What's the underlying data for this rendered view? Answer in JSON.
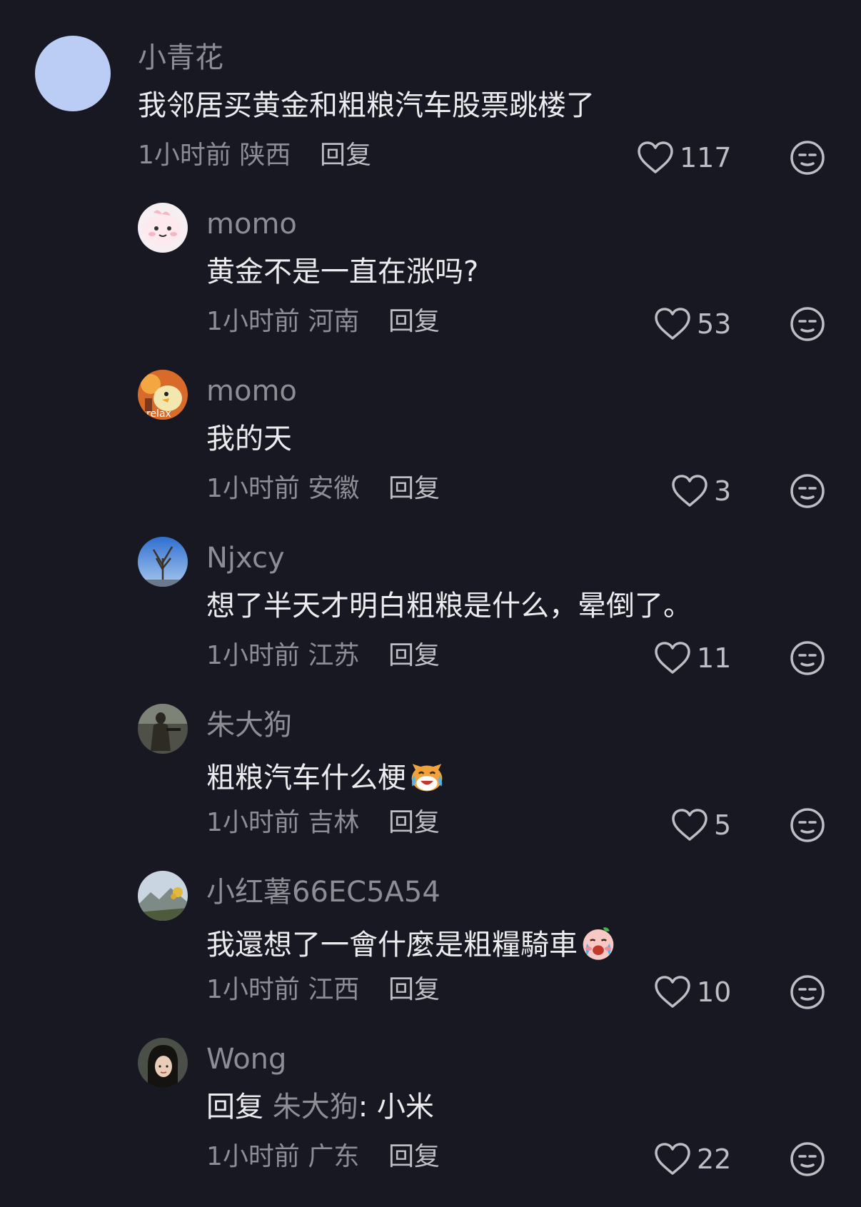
{
  "comments": [
    {
      "user": "小青花",
      "text": "我邻居买黄金和粗粮汽车股票跳楼了",
      "time": "1小时前",
      "region": "陕西",
      "reply": "回复",
      "likes": "117",
      "avatar_color": "#bccdf5"
    },
    {
      "user": "momo",
      "text": "黄金不是一直在涨吗?",
      "time": "1小时前",
      "region": "河南",
      "reply": "回复",
      "likes": "53",
      "avatar_icon": "pink-bunny-avatar"
    },
    {
      "user": "momo",
      "text": "我的天",
      "time": "1小时前",
      "region": "安徽",
      "reply": "回复",
      "likes": "3",
      "avatar_icon": "relax-duck-avatar",
      "avatar_text": "relax"
    },
    {
      "user": "Njxcy",
      "text": "想了半天才明白粗粮是什么，晕倒了。",
      "time": "1小时前",
      "region": "江苏",
      "reply": "回复",
      "likes": "11",
      "avatar_icon": "tree-sky-avatar"
    },
    {
      "user": "朱大狗",
      "text": "粗粮汽车什么梗",
      "emoji": "crying-laughing-cat-emoji",
      "time": "1小时前",
      "region": "吉林",
      "reply": "回复",
      "likes": "5",
      "avatar_icon": "soldier-photo-avatar"
    },
    {
      "user": "小红薯66EC5A54",
      "text": "我還想了一會什麼是粗糧騎車",
      "emoji": "crying-face-emoji",
      "time": "1小时前",
      "region": "江西",
      "reply": "回复",
      "likes": "10",
      "avatar_icon": "mountain-landscape-avatar"
    },
    {
      "user": "Wong",
      "reply_prefix": "回复",
      "mention": "朱大狗",
      "text": ": 小米",
      "time": "1小时前",
      "region": "广东",
      "reply": "回复",
      "likes": "22",
      "avatar_icon": "woman-portrait-avatar"
    }
  ],
  "colors": {
    "background": "#171821",
    "text": "#ececef",
    "muted": "#8d8d96"
  }
}
